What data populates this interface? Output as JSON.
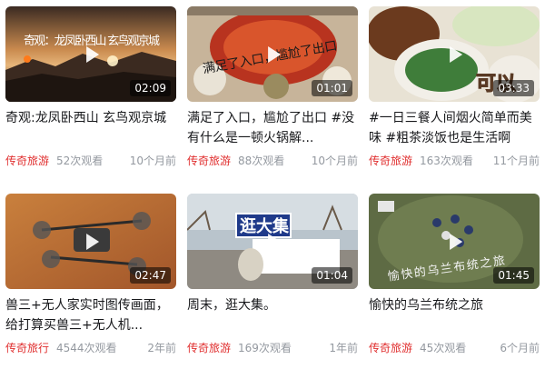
{
  "videos": [
    {
      "title": "奇观:龙凤卧西山 玄鸟观京城",
      "duration": "02:09",
      "channel": "传奇旅游",
      "views": "52次观看",
      "age": "10个月前"
    },
    {
      "title": "满足了入口，尴尬了出口 #没有什么是一顿火锅解...",
      "duration": "01:01",
      "channel": "传奇旅游",
      "views": "88次观看",
      "age": "10个月前"
    },
    {
      "title": "#一日三餐人间烟火简单而美味 #粗茶淡饭也是生活啊",
      "duration": "03:33",
      "channel": "传奇旅游",
      "views": "163次观看",
      "age": "11个月前"
    },
    {
      "title": "兽三+无人家实时图传画面，给打算买兽三+无人机...",
      "duration": "02:47",
      "channel": "传奇旅行",
      "views": "4544次观看",
      "age": "2年前"
    },
    {
      "title": "周末，逛大集。",
      "duration": "01:04",
      "channel": "传奇旅游",
      "views": "169次观看",
      "age": "1年前"
    },
    {
      "title": "愉快的乌兰布统之旅",
      "duration": "01:45",
      "channel": "传奇旅游",
      "views": "45次观看",
      "age": "6个月前"
    }
  ],
  "thumb_text": {
    "v1": "奇观：龙凤卧西山 玄鸟观京城",
    "v2": "满足了入口，尴尬了出口",
    "v3": "可以",
    "v5": "逛大集",
    "v6": "愉快的乌兰布统之旅"
  },
  "colors": {
    "channel": "#e02e2e",
    "meta": "#9499a0",
    "title": "#18191c"
  }
}
